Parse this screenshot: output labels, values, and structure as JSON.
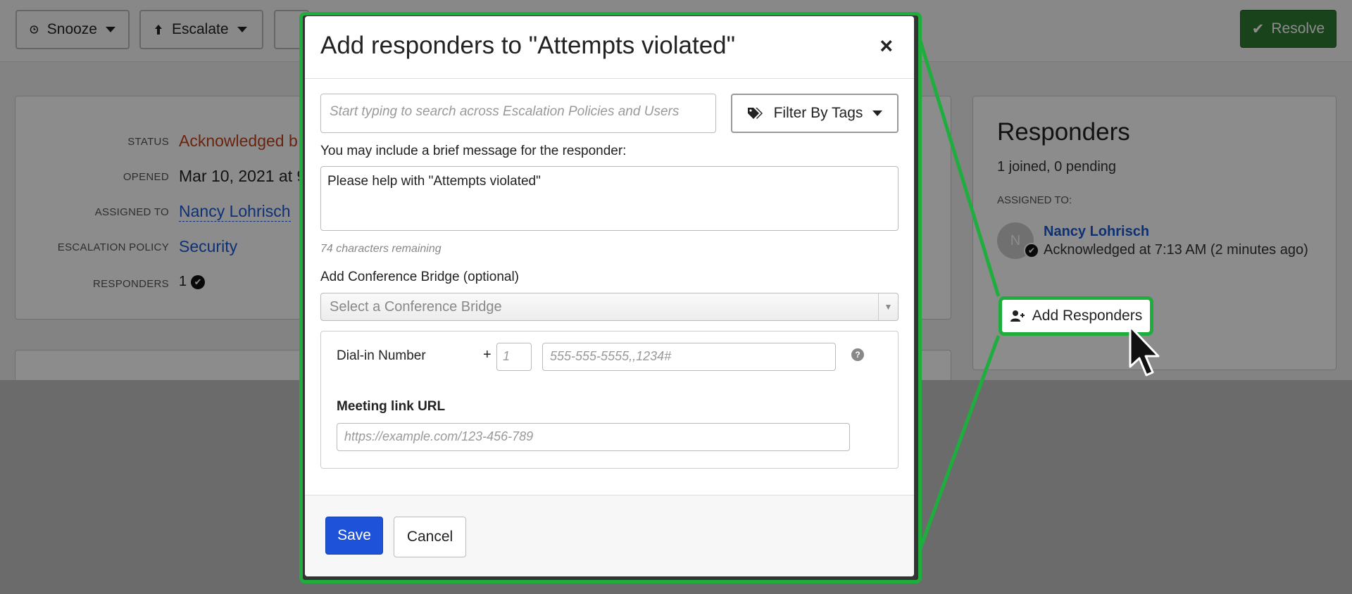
{
  "toolbar": {
    "snooze_label": "Snooze",
    "escalate_label": "Escalate",
    "resolve_label": "Resolve"
  },
  "details": {
    "status_label": "STATUS",
    "status_value": "Acknowledged b",
    "opened_label": "OPENED",
    "opened_value": "Mar 10, 2021 at 9",
    "assigned_label": "ASSIGNED TO",
    "assigned_value": "Nancy Lohrisch",
    "policy_label": "ESCALATION POLICY",
    "policy_value": "Security",
    "responders_label": "RESPONDERS",
    "responders_value": "1"
  },
  "responders_panel": {
    "title": "Responders",
    "summary": "1 joined, 0 pending",
    "assigned_to_label": "ASSIGNED TO:",
    "avatar_initial": "N",
    "name": "Nancy Lohrisch",
    "ack_text": "Acknowledged at 7:13 AM (2 minutes ago)",
    "add_button_label": "Add Responders"
  },
  "modal": {
    "title": "Add responders to \"Attempts violated\"",
    "close_symbol": "×",
    "search_placeholder": "Start typing to search across Escalation Policies and Users",
    "filter_label": "Filter By Tags",
    "message_label": "You may include a brief message for the responder:",
    "message_value": "Please help with \"Attempts violated\"",
    "remaining_text": "74 characters remaining",
    "bridge_label": "Add Conference Bridge (optional)",
    "bridge_placeholder": "Select a Conference Bridge",
    "dial_label": "Dial-in Number",
    "plus_sign": "+",
    "country_code_placeholder": "1",
    "phone_placeholder": "555-555-5555,,1234#",
    "meeting_label": "Meeting link URL",
    "meeting_placeholder": "https://example.com/123-456-789",
    "save_label": "Save",
    "cancel_label": "Cancel"
  },
  "colors": {
    "callout_green": "#1fae3e",
    "save_blue": "#1e52d8",
    "resolve_green": "#2f7d32",
    "status_orange": "#c0431d",
    "link_blue": "#1a5ad6"
  },
  "icons": [
    "clock-icon",
    "escalate-arrow-icon",
    "check-icon",
    "tags-icon",
    "user-plus-icon",
    "close-icon",
    "help-icon",
    "mouse-cursor-icon"
  ]
}
